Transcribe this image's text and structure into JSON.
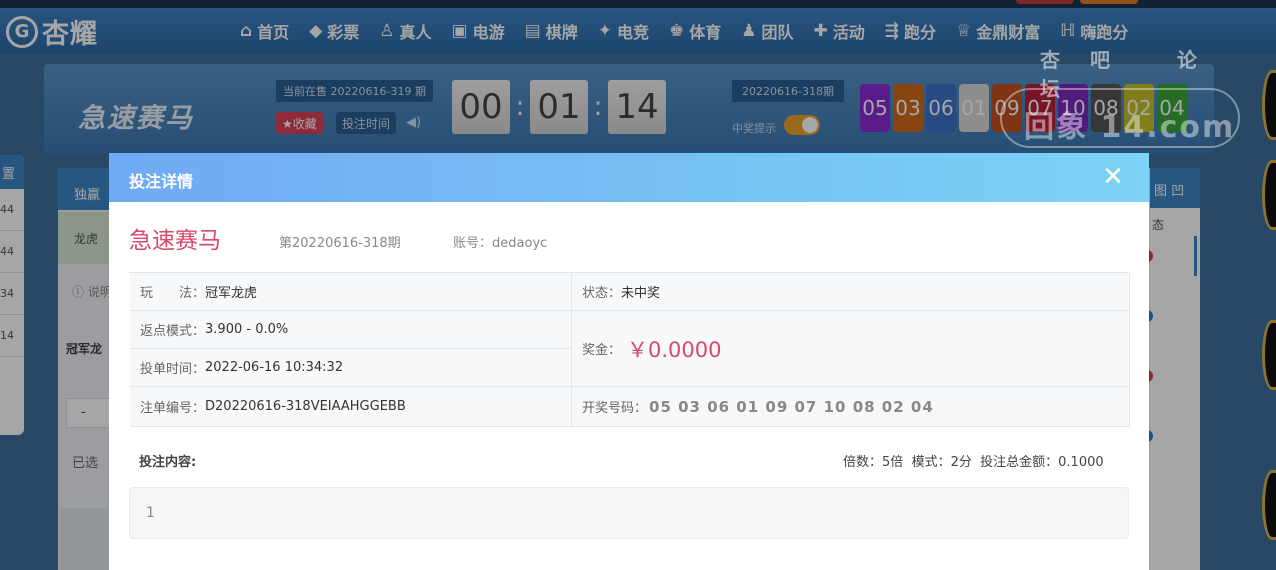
{
  "nav": {
    "logo_text": "杏耀",
    "items": [
      {
        "label": "首页",
        "icon": "home-icon",
        "glyph": "⌂"
      },
      {
        "label": "彩票",
        "icon": "lottery-icon",
        "glyph": "◆"
      },
      {
        "label": "真人",
        "icon": "live-icon",
        "glyph": "♙"
      },
      {
        "label": "电游",
        "icon": "slot-icon",
        "glyph": "▣"
      },
      {
        "label": "棋牌",
        "icon": "cards-icon",
        "glyph": "▤"
      },
      {
        "label": "电竞",
        "icon": "gamepad-icon",
        "glyph": "✦"
      },
      {
        "label": "体育",
        "icon": "trophy-icon",
        "glyph": "♚"
      },
      {
        "label": "团队",
        "icon": "team-icon",
        "glyph": "♟"
      },
      {
        "label": "活动",
        "icon": "gift-icon",
        "glyph": "✚"
      },
      {
        "label": "跑分",
        "icon": "car-icon",
        "glyph": "⇶"
      },
      {
        "label": "金鼎财富",
        "icon": "wealth-icon",
        "glyph": "♕"
      },
      {
        "label": "嗨跑分",
        "icon": "hi-icon",
        "glyph": "ℍ"
      }
    ]
  },
  "game_header": {
    "game_name": "急速赛马",
    "current_period": "当前在售 20220616-319 期",
    "favorite_label": "★收藏",
    "bet_time_label": "投注时间",
    "countdown": [
      "00",
      "01",
      "14"
    ],
    "last_period": "20220616-318期",
    "win_notice_label": "中奖提示",
    "balls": [
      "05",
      "03",
      "06",
      "01",
      "09",
      "07",
      "10",
      "08",
      "02",
      "04"
    ],
    "ball_colors": [
      "#8a2bd8",
      "#d26a1a",
      "#3d72c8",
      "#d9d9d9",
      "#c4501e",
      "#b91f3c",
      "#7b2ac0",
      "#555555",
      "#c5c028",
      "#39a83a"
    ]
  },
  "background": {
    "left_tab_label": "置",
    "left_values": [
      "44",
      "44",
      "34",
      "14"
    ],
    "tab_label": "独赢",
    "row_label": "龙虎",
    "tip_label": "说明",
    "sub_label": "冠军龙",
    "stepper_label": "-",
    "selected_label": "已选",
    "right_header": "图 凹",
    "right_sub": "态"
  },
  "watermark": {
    "top": "杏吧 论坛",
    "main": "回象 14.com"
  },
  "modal": {
    "title": "投注详情",
    "close_glyph": "✕",
    "game_name": "急速赛马",
    "period": "第20220616-318期",
    "account_label": "账号：",
    "account": "dedaoyc",
    "play_label": "玩　　法：",
    "play_value": "冠军龙虎",
    "status_label": "状态：",
    "status_value": "未中奖",
    "rebate_label": "返点模式：",
    "rebate_value": "3.900 - 0.0%",
    "prize_label": "奖金：",
    "prize_value": "￥0.0000",
    "bet_time_label": "投单时间：",
    "bet_time_value": "2022-06-16 10:34:32",
    "order_label": "注单编号：",
    "order_value": "D20220616-318VEIAAHGGEBB",
    "draw_label": "开奖号码：",
    "draw_value": "05 03 06 01 09 07 10 08 02 04",
    "content_label": "投注内容:",
    "multiplier_label": "倍数：",
    "multiplier_value": "5倍",
    "mode_label": "模式：",
    "mode_value": "2分",
    "total_label": "投注总金额：",
    "total_value": "0.1000",
    "content_value": "1"
  }
}
